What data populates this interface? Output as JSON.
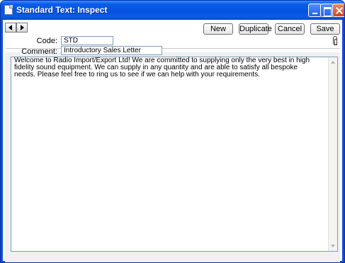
{
  "window": {
    "title": "Standard Text: Inspect"
  },
  "toolbar": {
    "new_label": "New",
    "duplicate_label": "Duplicate",
    "cancel_label": "Cancel",
    "save_label": "Save"
  },
  "form": {
    "code_label": "Code:",
    "code_value": "STD",
    "comment_label": "Comment:",
    "comment_value": "Introductory Sales Letter",
    "body_text": "Welcome to Radio Import/Export Ltd! We are committed to supplying only the very best in high fidelity sound equipment. We can supply in any quantity and are able to satisfy all bespoke needs. Please feel free to ring us to see if we can help with your requirements."
  }
}
